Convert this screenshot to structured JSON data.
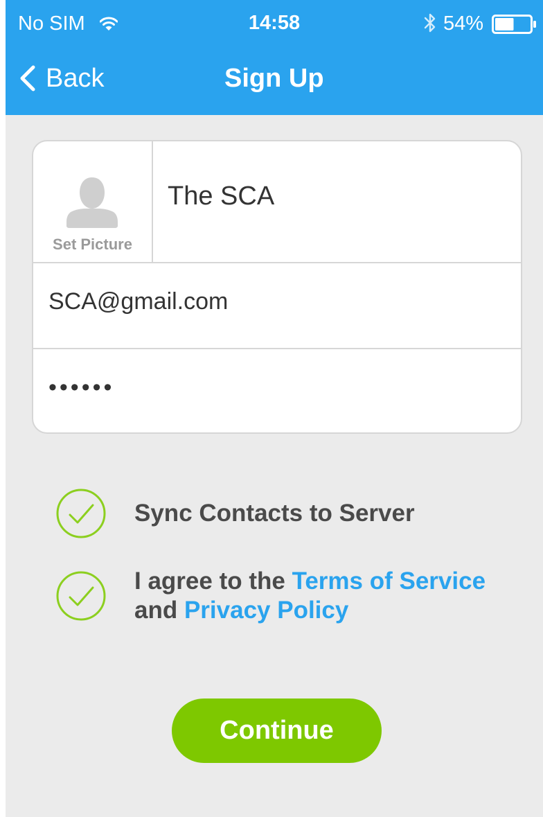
{
  "status_bar": {
    "carrier": "No SIM",
    "time": "14:58",
    "battery_percent": "54%",
    "battery_level": 0.54,
    "icons": [
      "wifi-icon",
      "bluetooth-icon",
      "battery-icon"
    ]
  },
  "nav": {
    "back_label": "Back",
    "title": "Sign Up",
    "back_icon": "chevron-left-icon"
  },
  "form": {
    "avatar_icon": "person-silhouette-icon",
    "set_picture_label": "Set Picture",
    "name_value": "The SCA",
    "email_value": "SCA@gmail.com",
    "password_value": "••••••"
  },
  "options": {
    "sync_label": "Sync Contacts to Server",
    "sync_checked": true,
    "terms_prefix": "I agree to the ",
    "terms_link": "Terms of Service",
    "terms_middle": " and ",
    "privacy_link": "Privacy Policy",
    "terms_checked": true,
    "check_icon": "checkmark-circle-icon"
  },
  "continue_label": "Continue",
  "colors": {
    "header": "#2aa3ee",
    "accent_green": "#7ec800",
    "check_green": "#8ccf1f",
    "link_blue": "#2aa3ee",
    "background": "#ebebeb"
  }
}
